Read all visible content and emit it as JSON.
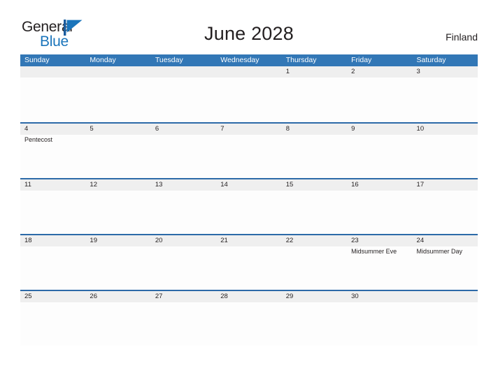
{
  "brand": {
    "name_part1": "General",
    "name_part2": "Blue",
    "flag_icon": "blue-flag-icon",
    "accent_color": "#1b75bb"
  },
  "header": {
    "title": "June 2028",
    "country": "Finland"
  },
  "calendar": {
    "header_bg": "#3277b6",
    "header_text_color": "#ffffff",
    "row_divider_color": "#2c6aa8",
    "date_strip_color": "#efefef",
    "cell_bg": "#fdfdfd",
    "weekdays": [
      "Sunday",
      "Monday",
      "Tuesday",
      "Wednesday",
      "Thursday",
      "Friday",
      "Saturday"
    ],
    "weeks": [
      [
        {
          "day": "",
          "events": []
        },
        {
          "day": "",
          "events": []
        },
        {
          "day": "",
          "events": []
        },
        {
          "day": "",
          "events": []
        },
        {
          "day": "1",
          "events": []
        },
        {
          "day": "2",
          "events": []
        },
        {
          "day": "3",
          "events": []
        }
      ],
      [
        {
          "day": "4",
          "events": [
            "Pentecost"
          ]
        },
        {
          "day": "5",
          "events": []
        },
        {
          "day": "6",
          "events": []
        },
        {
          "day": "7",
          "events": []
        },
        {
          "day": "8",
          "events": []
        },
        {
          "day": "9",
          "events": []
        },
        {
          "day": "10",
          "events": []
        }
      ],
      [
        {
          "day": "11",
          "events": []
        },
        {
          "day": "12",
          "events": []
        },
        {
          "day": "13",
          "events": []
        },
        {
          "day": "14",
          "events": []
        },
        {
          "day": "15",
          "events": []
        },
        {
          "day": "16",
          "events": []
        },
        {
          "day": "17",
          "events": []
        }
      ],
      [
        {
          "day": "18",
          "events": []
        },
        {
          "day": "19",
          "events": []
        },
        {
          "day": "20",
          "events": []
        },
        {
          "day": "21",
          "events": []
        },
        {
          "day": "22",
          "events": []
        },
        {
          "day": "23",
          "events": [
            "Midsummer Eve"
          ]
        },
        {
          "day": "24",
          "events": [
            "Midsummer Day"
          ]
        }
      ],
      [
        {
          "day": "25",
          "events": []
        },
        {
          "day": "26",
          "events": []
        },
        {
          "day": "27",
          "events": []
        },
        {
          "day": "28",
          "events": []
        },
        {
          "day": "29",
          "events": []
        },
        {
          "day": "30",
          "events": []
        },
        {
          "day": "",
          "events": []
        }
      ]
    ]
  }
}
